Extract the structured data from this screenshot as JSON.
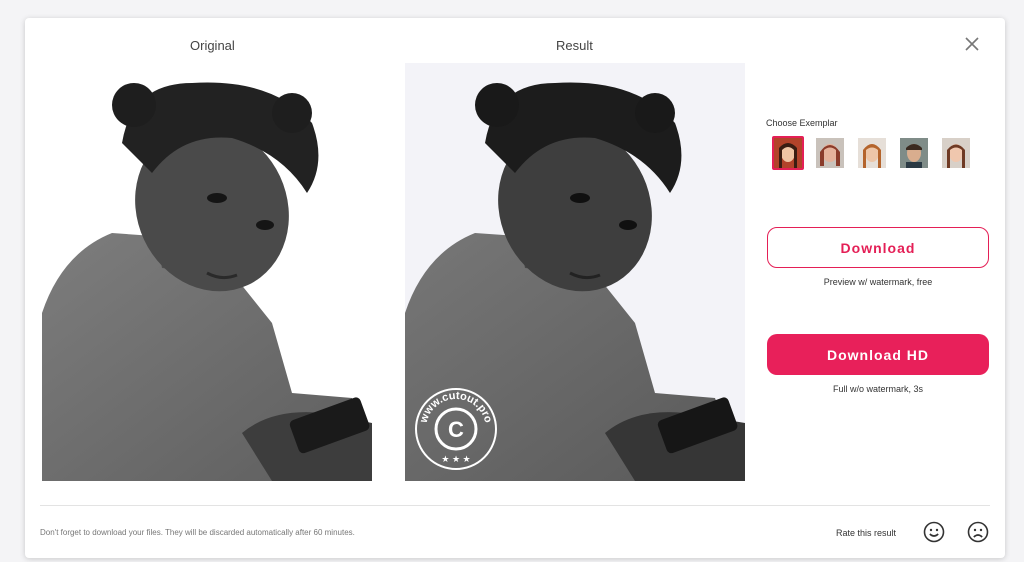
{
  "panels": {
    "original_title": "Original",
    "result_title": "Result"
  },
  "watermark": {
    "text": "www.cutout.pro",
    "logo_letter": "C"
  },
  "exemplar": {
    "label": "Choose Exemplar",
    "selected_index": 0,
    "items": [
      "exemplar-1",
      "exemplar-2",
      "exemplar-3",
      "exemplar-4",
      "exemplar-5"
    ]
  },
  "actions": {
    "download_label": "Download",
    "download_sub": "Preview w/ watermark, free",
    "download_hd_label": "Download HD",
    "download_hd_sub": "Full w/o watermark, 3s"
  },
  "footer": {
    "note": "Don't forget to download your files. They will be discarded automatically after 60 minutes.",
    "rate_label": "Rate this result"
  },
  "icons": {
    "close": "close-icon",
    "happy": "smiley-happy-icon",
    "sad": "smiley-sad-icon"
  },
  "colors": {
    "accent": "#e8205a",
    "selected_border": "#e41f56"
  }
}
